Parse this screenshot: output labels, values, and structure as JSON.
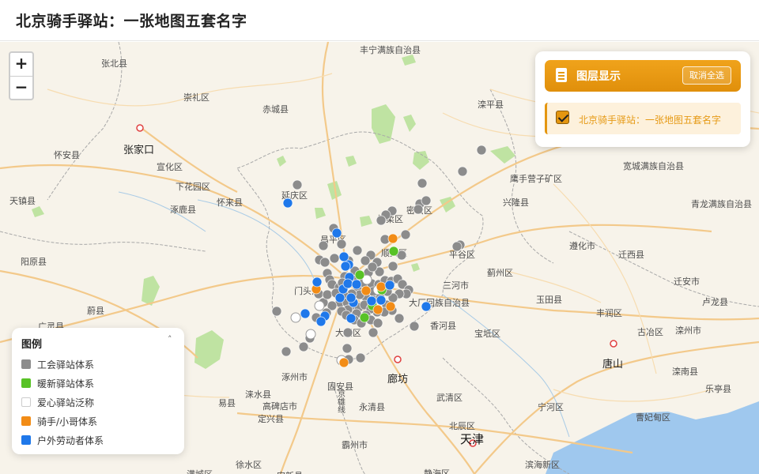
{
  "header": {
    "title": "北京骑手驿站：一张地图五套名字"
  },
  "zoom": {
    "in_label": "+",
    "out_label": "−"
  },
  "layer_panel": {
    "title": "图层显示",
    "toggle_button": "取消全选",
    "layer_label": "北京骑手驿站：一张地图五套名字",
    "checked": true
  },
  "legend": {
    "title": "图例",
    "collapse_glyph": "˄",
    "items": [
      {
        "label": "工会驿站体系",
        "color": "#8c8c8c"
      },
      {
        "label": "暖新驿站体系",
        "color": "#58c226"
      },
      {
        "label": "爱心驿站泛称",
        "color": "#ffffff"
      },
      {
        "label": "骑手/小哥体系",
        "color": "#f28c16"
      },
      {
        "label": "户外劳动者体系",
        "color": "#1f78ea"
      }
    ]
  },
  "places": [
    {
      "name": "丰宁满族自治县",
      "kind": "county"
    },
    {
      "name": "张北县",
      "kind": "county"
    },
    {
      "name": "崇礼区",
      "kind": "county"
    },
    {
      "name": "赤城县",
      "kind": "county"
    },
    {
      "name": "滦平县",
      "kind": "county"
    },
    {
      "name": "张家口",
      "kind": "city"
    },
    {
      "name": "怀安县",
      "kind": "county"
    },
    {
      "name": "宣化区",
      "kind": "county"
    },
    {
      "name": "下花园区",
      "kind": "county"
    },
    {
      "name": "怀来县",
      "kind": "county"
    },
    {
      "name": "涿鹿县",
      "kind": "county"
    },
    {
      "name": "天镇县",
      "kind": "county"
    },
    {
      "name": "延庆区",
      "kind": "county"
    },
    {
      "name": "怀柔区",
      "kind": "county"
    },
    {
      "name": "密云区",
      "kind": "county"
    },
    {
      "name": "鹰手营子矿区",
      "kind": "county"
    },
    {
      "name": "宽城满族自治县",
      "kind": "county"
    },
    {
      "name": "兴隆县",
      "kind": "county"
    },
    {
      "name": "青龙满族自治县",
      "kind": "county"
    },
    {
      "name": "阳原县",
      "kind": "county"
    },
    {
      "name": "昌平区",
      "kind": "county"
    },
    {
      "name": "顺义区",
      "kind": "county"
    },
    {
      "name": "平谷区",
      "kind": "county"
    },
    {
      "name": "遵化市",
      "kind": "county"
    },
    {
      "name": "迁西县",
      "kind": "county"
    },
    {
      "name": "蓟州区",
      "kind": "county"
    },
    {
      "name": "三河市",
      "kind": "county"
    },
    {
      "name": "迁安市",
      "kind": "county"
    },
    {
      "name": "门头沟",
      "kind": "county"
    },
    {
      "name": "大厂回族自治县",
      "kind": "county"
    },
    {
      "name": "玉田县",
      "kind": "county"
    },
    {
      "name": "卢龙县",
      "kind": "county"
    },
    {
      "name": "蔚县",
      "kind": "county"
    },
    {
      "name": "丰润区",
      "kind": "county"
    },
    {
      "name": "香河县",
      "kind": "county"
    },
    {
      "name": "广灵县",
      "kind": "county"
    },
    {
      "name": "大兴区",
      "kind": "county"
    },
    {
      "name": "宝坻区",
      "kind": "county"
    },
    {
      "name": "古冶区",
      "kind": "county"
    },
    {
      "name": "滦州市",
      "kind": "county"
    },
    {
      "name": "唐山",
      "kind": "city"
    },
    {
      "name": "涿州市",
      "kind": "county"
    },
    {
      "name": "廊坊",
      "kind": "city"
    },
    {
      "name": "滦南县",
      "kind": "county"
    },
    {
      "name": "易县",
      "kind": "county"
    },
    {
      "name": "涞水县",
      "kind": "county"
    },
    {
      "name": "固安县",
      "kind": "county"
    },
    {
      "name": "乐亭县",
      "kind": "county"
    },
    {
      "name": "高碑店市",
      "kind": "county"
    },
    {
      "name": "永清县",
      "kind": "county"
    },
    {
      "name": "武清区",
      "kind": "county"
    },
    {
      "name": "定兴县",
      "kind": "county"
    },
    {
      "name": "宁河区",
      "kind": "county"
    },
    {
      "name": "曹妃甸区",
      "kind": "county"
    },
    {
      "name": "北辰区",
      "kind": "county"
    },
    {
      "name": "天津",
      "kind": "city"
    },
    {
      "name": "霸州市",
      "kind": "county"
    },
    {
      "name": "徐水区",
      "kind": "county"
    },
    {
      "name": "滨海新区",
      "kind": "county"
    },
    {
      "name": "安新县",
      "kind": "county"
    },
    {
      "name": "静海区",
      "kind": "county"
    },
    {
      "name": "满城区",
      "kind": "county"
    },
    {
      "name": "京雄线",
      "kind": "road"
    }
  ],
  "stations": {
    "union": [
      [
        609,
        137
      ],
      [
        585,
        164
      ],
      [
        376,
        181
      ],
      [
        534,
        179
      ],
      [
        496,
        214
      ],
      [
        488,
        219
      ],
      [
        482,
        226
      ],
      [
        531,
        205
      ],
      [
        539,
        201
      ],
      [
        529,
        212
      ],
      [
        513,
        244
      ],
      [
        487,
        250
      ],
      [
        422,
        236
      ],
      [
        409,
        258
      ],
      [
        404,
        276
      ],
      [
        411,
        279
      ],
      [
        423,
        274
      ],
      [
        432,
        256
      ],
      [
        452,
        264
      ],
      [
        469,
        270
      ],
      [
        477,
        279
      ],
      [
        497,
        284
      ],
      [
        508,
        270
      ],
      [
        414,
        293
      ],
      [
        417,
        301
      ],
      [
        436,
        297
      ],
      [
        449,
        290
      ],
      [
        466,
        292
      ],
      [
        480,
        291
      ],
      [
        462,
        277
      ],
      [
        441,
        277
      ],
      [
        420,
        307
      ],
      [
        429,
        311
      ],
      [
        433,
        305
      ],
      [
        446,
        301
      ],
      [
        452,
        310
      ],
      [
        460,
        305
      ],
      [
        470,
        306
      ],
      [
        479,
        307
      ],
      [
        487,
        302
      ],
      [
        495,
        303
      ],
      [
        503,
        300
      ],
      [
        509,
        307
      ],
      [
        517,
        314
      ],
      [
        514,
        319
      ],
      [
        505,
        319
      ],
      [
        497,
        324
      ],
      [
        490,
        316
      ],
      [
        472,
        316
      ],
      [
        462,
        322
      ],
      [
        455,
        320
      ],
      [
        445,
        319
      ],
      [
        436,
        322
      ],
      [
        430,
        330
      ],
      [
        420,
        334
      ],
      [
        409,
        330
      ],
      [
        403,
        319
      ],
      [
        414,
        320
      ],
      [
        425,
        318
      ],
      [
        439,
        330
      ],
      [
        447,
        333
      ],
      [
        454,
        336
      ],
      [
        461,
        333
      ],
      [
        473,
        327
      ],
      [
        481,
        324
      ],
      [
        489,
        333
      ],
      [
        496,
        340
      ],
      [
        486,
        342
      ],
      [
        477,
        342
      ],
      [
        469,
        338
      ],
      [
        463,
        346
      ],
      [
        451,
        344
      ],
      [
        440,
        339
      ],
      [
        432,
        341
      ],
      [
        413,
        343
      ],
      [
        438,
        346
      ],
      [
        448,
        352
      ],
      [
        469,
        352
      ],
      [
        478,
        356
      ],
      [
        505,
        350
      ],
      [
        524,
        360
      ],
      [
        440,
        368
      ],
      [
        457,
        356
      ],
      [
        350,
        341
      ],
      [
        362,
        392
      ],
      [
        384,
        386
      ],
      [
        392,
        375
      ],
      [
        439,
        388
      ],
      [
        456,
        400
      ],
      [
        441,
        402
      ],
      [
        472,
        368
      ],
      [
        471,
        285
      ],
      [
        582,
        257
      ],
      [
        578,
        259
      ],
      [
        400,
        349
      ]
    ],
    "warm": [
      [
        498,
        265
      ],
      [
        455,
        295
      ],
      [
        483,
        314
      ],
      [
        461,
        349
      ],
      [
        471,
        334
      ]
    ],
    "love": [
      [
        464,
        301
      ],
      [
        374,
        349
      ],
      [
        404,
        334
      ],
      [
        393,
        370
      ],
      [
        432,
        403
      ],
      [
        478,
        314
      ]
    ],
    "rider": [
      [
        497,
        249
      ],
      [
        400,
        313
      ],
      [
        463,
        315
      ],
      [
        482,
        310
      ],
      [
        494,
        335
      ],
      [
        435,
        406
      ],
      [
        478,
        339
      ]
    ],
    "outdoor": [
      [
        364,
        204
      ],
      [
        426,
        242
      ],
      [
        441,
        282
      ],
      [
        435,
        272
      ],
      [
        442,
        298
      ],
      [
        401,
        304
      ],
      [
        411,
        347
      ],
      [
        386,
        344
      ],
      [
        406,
        354
      ],
      [
        444,
        350
      ],
      [
        447,
        330
      ],
      [
        430,
        324
      ],
      [
        434,
        313
      ],
      [
        437,
        284
      ],
      [
        440,
        306
      ],
      [
        451,
        307
      ],
      [
        470,
        328
      ],
      [
        482,
        327
      ],
      [
        539,
        335
      ],
      [
        493,
        308
      ],
      [
        444,
        324
      ]
    ]
  }
}
